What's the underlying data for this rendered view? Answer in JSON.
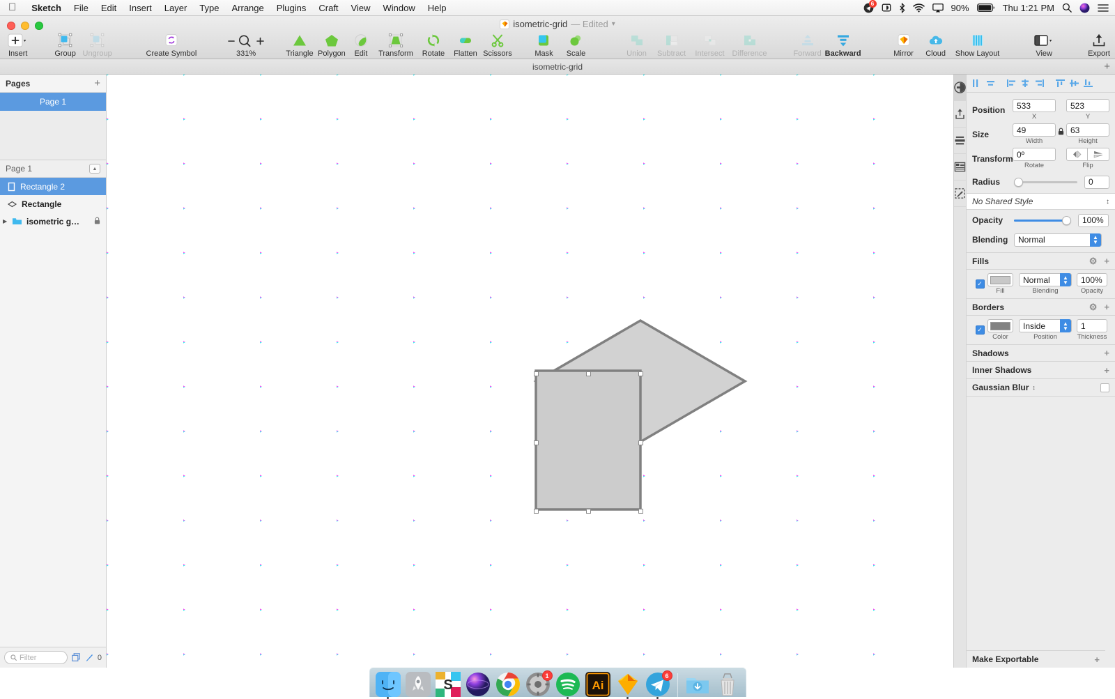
{
  "menubar": {
    "apple_icon": "apple-icon",
    "items": [
      {
        "label": "Sketch",
        "bold": true
      },
      {
        "label": "File",
        "bold": false
      },
      {
        "label": "Edit",
        "bold": false
      },
      {
        "label": "Insert",
        "bold": false
      },
      {
        "label": "Layer",
        "bold": false
      },
      {
        "label": "Type",
        "bold": false
      },
      {
        "label": "Arrange",
        "bold": false
      },
      {
        "label": "Plugins",
        "bold": false
      },
      {
        "label": "Craft",
        "bold": false
      },
      {
        "label": "View",
        "bold": false
      },
      {
        "label": "Window",
        "bold": false
      },
      {
        "label": "Help",
        "bold": false
      }
    ],
    "status": {
      "notification_badge": "6",
      "battery_percent": "90%",
      "clock": "Thu 1:21 PM",
      "icons": [
        "telegram-menu-icon",
        "cleanmymac-icon",
        "bluetooth-icon",
        "wifi-icon",
        "airplay-icon",
        "battery-icon",
        "spotlight-search-icon",
        "siri-icon",
        "notification-center-icon"
      ]
    }
  },
  "window": {
    "title": "isometric-grid",
    "edited_label": "— Edited",
    "tab_title": "isometric-grid"
  },
  "toolbar": {
    "groups": [
      [
        {
          "label": "Insert",
          "icon": "insert-plus-icon",
          "dim": false,
          "bold": false
        },
        {
          "label": "Group",
          "icon": "group-icon",
          "dim": false,
          "bold": false
        },
        {
          "label": "Ungroup",
          "icon": "ungroup-icon",
          "dim": true,
          "bold": false
        },
        {
          "label": "Create Symbol",
          "icon": "create-symbol-icon",
          "dim": false,
          "bold": false
        }
      ],
      [
        {
          "label": "331%",
          "icon": "zoom-icon",
          "dim": false,
          "bold": false
        }
      ],
      [
        {
          "label": "Triangle",
          "icon": "triangle-icon",
          "dim": false,
          "bold": false
        },
        {
          "label": "Polygon",
          "icon": "polygon-icon",
          "dim": false,
          "bold": false
        },
        {
          "label": "Edit",
          "icon": "edit-icon",
          "dim": false,
          "bold": false
        },
        {
          "label": "Transform",
          "icon": "transform-icon",
          "dim": false,
          "bold": false
        },
        {
          "label": "Rotate",
          "icon": "rotate-icon",
          "dim": false,
          "bold": false
        },
        {
          "label": "Flatten",
          "icon": "flatten-icon",
          "dim": false,
          "bold": false
        },
        {
          "label": "Scissors",
          "icon": "scissors-icon",
          "dim": false,
          "bold": false
        },
        {
          "label": "Mask",
          "icon": "mask-icon",
          "dim": false,
          "bold": false
        },
        {
          "label": "Scale",
          "icon": "scale-icon",
          "dim": false,
          "bold": false
        }
      ],
      [
        {
          "label": "Union",
          "icon": "union-icon",
          "dim": true,
          "bold": false
        },
        {
          "label": "Subtract",
          "icon": "subtract-icon",
          "dim": true,
          "bold": false
        },
        {
          "label": "Intersect",
          "icon": "intersect-icon",
          "dim": true,
          "bold": false
        },
        {
          "label": "Difference",
          "icon": "difference-icon",
          "dim": true,
          "bold": false
        },
        {
          "label": "Forward",
          "icon": "forward-icon",
          "dim": true,
          "bold": false
        },
        {
          "label": "Backward",
          "icon": "backward-icon",
          "dim": false,
          "bold": true
        },
        {
          "label": "Mirror",
          "icon": "mirror-icon",
          "dim": false,
          "bold": false
        },
        {
          "label": "Cloud",
          "icon": "cloud-icon",
          "dim": false,
          "bold": false
        },
        {
          "label": "Show Layout",
          "icon": "show-layout-icon",
          "dim": false,
          "bold": false
        },
        {
          "label": "View",
          "icon": "view-icon",
          "dim": false,
          "bold": false
        },
        {
          "label": "Export",
          "icon": "export-icon",
          "dim": false,
          "bold": false
        }
      ]
    ],
    "zoom_level": "331%",
    "zoom_minus": "−",
    "zoom_plus": "+"
  },
  "sidebar": {
    "pages_header": "Pages",
    "pages_add": "+",
    "pages": [
      {
        "label": "Page 1",
        "selected": true
      }
    ],
    "layers_header": "Page 1",
    "layers": [
      {
        "label": "Rectangle 2",
        "icon": "rectangle-layer-icon",
        "selected": true,
        "locked": false,
        "group": false
      },
      {
        "label": "Rectangle",
        "icon": "diamond-layer-icon",
        "selected": false,
        "locked": false,
        "group": false
      },
      {
        "label": "isometric g…",
        "icon": "folder-layer-icon",
        "selected": false,
        "locked": true,
        "group": true
      }
    ],
    "filter_placeholder": "Filter",
    "footer_count": "0"
  },
  "inspector": {
    "align_icons": [
      "align-left-icon",
      "align-center-h-icon",
      "align-right-icon",
      "distribute-h-icon",
      "align-top-icon",
      "align-middle-icon",
      "align-bottom-icon",
      "distribute-v-icon"
    ],
    "rail_icons": [
      "inspector-icon",
      "export-panel-icon",
      "layout-panel-icon",
      "grid-panel-icon",
      "style-panel-icon"
    ],
    "position": {
      "label": "Position",
      "x": "533",
      "y": "523",
      "x_sub": "X",
      "y_sub": "Y"
    },
    "size": {
      "label": "Size",
      "width": "49",
      "height": "63",
      "w_sub": "Width",
      "h_sub": "Height",
      "lock_icon": "lock-icon"
    },
    "transform": {
      "label": "Transform",
      "rotate": "0º",
      "rotate_sub": "Rotate",
      "flip_sub": "Flip",
      "flip_h_icon": "flip-horizontal-icon",
      "flip_v_icon": "flip-vertical-icon"
    },
    "radius": {
      "label": "Radius",
      "value": "0"
    },
    "shared_style": "No Shared Style",
    "opacity": {
      "label": "Opacity",
      "value": "100%"
    },
    "blending": {
      "label": "Blending",
      "value": "Normal"
    },
    "fills": {
      "header": "Fills",
      "gear_icon": "gear-icon",
      "add_icon": "plus-icon",
      "enabled": true,
      "fill_sub": "Fill",
      "blending_sub": "Blending",
      "opacity_sub": "Opacity",
      "blending": "Normal",
      "opacity": "100%",
      "color": "#c8c8c8"
    },
    "borders": {
      "header": "Borders",
      "gear_icon": "gear-icon",
      "add_icon": "plus-icon",
      "enabled": true,
      "color_sub": "Color",
      "position_sub": "Position",
      "thickness_sub": "Thickness",
      "position": "Inside",
      "thickness": "1",
      "color": "#828282"
    },
    "shadows": {
      "header": "Shadows",
      "add": "+"
    },
    "inner_shadows": {
      "header": "Inner Shadows",
      "add": "+"
    },
    "gaussian_blur": {
      "header": "Gaussian Blur",
      "enabled": false
    },
    "make_exportable": {
      "header": "Make Exportable",
      "add": "+"
    }
  },
  "canvas": {
    "grid": {
      "cyan": "#2ee8ef",
      "magenta": "#f13df1",
      "angle_deg": 30,
      "spacing": 64
    },
    "shapes": [
      {
        "name": "diamond-top",
        "fill": "#d2d2d2",
        "stroke": "#808080"
      },
      {
        "name": "selected-rectangle",
        "fill": "#cccccc",
        "stroke": "#808080",
        "selected": true
      }
    ]
  },
  "dock": {
    "apps": [
      {
        "name": "finder",
        "running": true,
        "badge": null
      },
      {
        "name": "launchpad",
        "running": false,
        "badge": null
      },
      {
        "name": "slack",
        "running": false,
        "badge": null
      },
      {
        "name": "siri",
        "running": false,
        "badge": null
      },
      {
        "name": "chrome",
        "running": true,
        "badge": null
      },
      {
        "name": "system-preferences",
        "running": false,
        "badge": "1"
      },
      {
        "name": "spotify",
        "running": true,
        "badge": null
      },
      {
        "name": "illustrator",
        "running": false,
        "badge": null
      },
      {
        "name": "sketch",
        "running": true,
        "badge": null
      },
      {
        "name": "telegram",
        "running": true,
        "badge": "6"
      },
      {
        "name": "downloads-folder",
        "running": false,
        "badge": null
      },
      {
        "name": "trash",
        "running": false,
        "badge": null
      }
    ]
  }
}
